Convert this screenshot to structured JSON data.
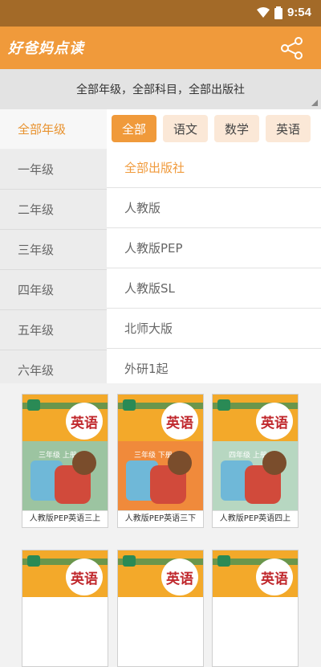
{
  "status_bar": {
    "time": "9:54"
  },
  "app": {
    "title": "好爸妈点读"
  },
  "filter": {
    "summary": "全部年级，全部科目，全部出版社"
  },
  "grades": [
    {
      "label": "全部年级",
      "active": true
    },
    {
      "label": "一年级"
    },
    {
      "label": "二年级"
    },
    {
      "label": "三年级"
    },
    {
      "label": "四年级"
    },
    {
      "label": "五年级"
    },
    {
      "label": "六年级"
    }
  ],
  "subjects": [
    {
      "label": "全部",
      "active": true
    },
    {
      "label": "语文"
    },
    {
      "label": "数学"
    },
    {
      "label": "英语"
    }
  ],
  "publishers": [
    {
      "label": "全部出版社",
      "active": true
    },
    {
      "label": "人教版"
    },
    {
      "label": "人教版PEP"
    },
    {
      "label": "人教版SL"
    },
    {
      "label": "北师大版"
    },
    {
      "label": "外研1起"
    }
  ],
  "books": [
    {
      "cover_title": "英语",
      "grade_tag": "三年级 上册",
      "caption": "人教版PEP英语三上",
      "body_color": "#9cc4a1"
    },
    {
      "cover_title": "英语",
      "grade_tag": "三年级 下册",
      "caption": "人教版PEP英语三下",
      "body_color": "#f08a3b"
    },
    {
      "cover_title": "英语",
      "grade_tag": "四年级 上册",
      "caption": "人教版PEP英语四上",
      "body_color": "#b7d7c1"
    },
    {
      "cover_title": "英语",
      "grade_tag": "",
      "caption": "",
      "body_color": "#f3a92a"
    },
    {
      "cover_title": "英语",
      "grade_tag": "",
      "caption": "",
      "body_color": "#f3a92a"
    },
    {
      "cover_title": "英语",
      "grade_tag": "",
      "caption": "",
      "body_color": "#f3a92a"
    }
  ],
  "colors": {
    "primary": "#f09a3b",
    "status_bar": "#a36a28"
  }
}
